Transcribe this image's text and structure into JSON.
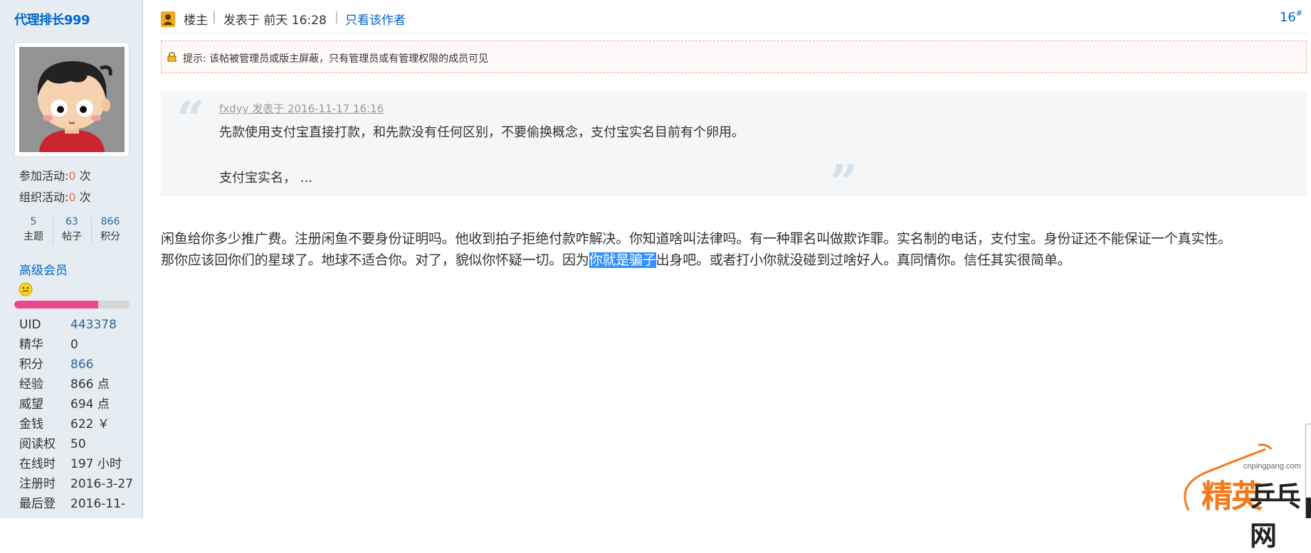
{
  "sidebar": {
    "username": "代理排长999",
    "activities": [
      {
        "label": "参加活动:",
        "count": "0",
        "unit": " 次"
      },
      {
        "label": "组织活动:",
        "count": "0",
        "unit": " 次"
      }
    ],
    "stats": [
      {
        "value": "5",
        "label": "主题"
      },
      {
        "value": "63",
        "label": "帖子"
      },
      {
        "value": "866",
        "label": "积分"
      }
    ],
    "usergroup": "高级会员",
    "credit_progress": 0.73,
    "info": [
      {
        "key": "UID",
        "value": "443378"
      },
      {
        "key": "精华",
        "value": "0"
      },
      {
        "key": "积分",
        "value": "866"
      },
      {
        "key": "经验",
        "value": "866 点"
      },
      {
        "key": "威望",
        "value": "694 点"
      },
      {
        "key": "金钱",
        "value": "622 ￥"
      },
      {
        "key": "阅读权",
        "value": "50"
      },
      {
        "key": "在线时",
        "value": "197 小时"
      },
      {
        "key": "注册时",
        "value": "2016-3-27"
      },
      {
        "key": "最后登",
        "value": "2016-11-"
      }
    ]
  },
  "post": {
    "role": "楼主",
    "pipe": "|",
    "posted_at": "发表于 前天 16:28",
    "only_author": "只看该作者",
    "floor": "16",
    "floor_suffix": "#",
    "notice": "提示: 该帖被管理员或版主屏蔽，只有管理员或有管理权限的成员可见",
    "quote": {
      "open_mark": "“",
      "close_mark": "”",
      "meta": "fxdyy 发表于 2016-11-17 16:16",
      "line1": "先款使用支付宝直接打款，和先款没有任何区别，不要偷换概念，支付宝实名目前有个卵用。",
      "line2": "支付宝实名， ..."
    },
    "body": {
      "line1": "闲鱼给你多少推广费。注册闲鱼不要身份证明吗。他收到拍子拒绝付款咋解决。你知道啥叫法律吗。有一种罪名叫做欺诈罪。实名制的电话，支付宝。身份证还不能保证一个真实性。",
      "line2_before": "那你应该回你们的星球了。地球不适合你。对了，貌似你怀疑一切。因为",
      "line2_selected": "你就是骗子",
      "line2_after": "出身吧。或者打小你就没碰到过啥好人。真同情你。信任其实很简单。"
    }
  },
  "watermark": {
    "site": "cnpingpang.com",
    "text1": "精英",
    "text2": "乒乓网"
  },
  "colors": {
    "link": "#0066cc",
    "accent_red": "#f26c4f",
    "sidebar_bg": "#e5edf2",
    "selection": "#3390ff",
    "progress": "#ea4a8c"
  }
}
